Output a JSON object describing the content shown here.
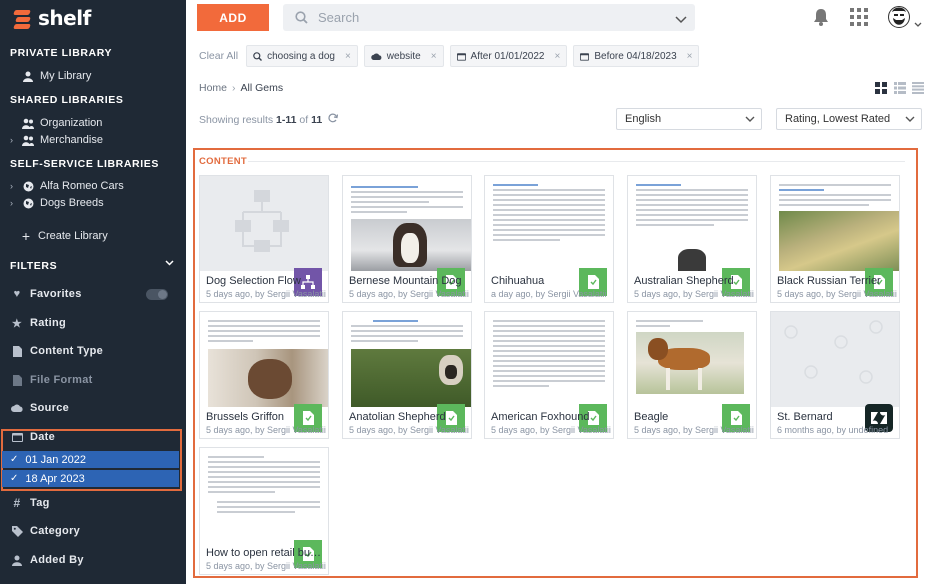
{
  "brand": {
    "name": "shelf"
  },
  "sidebar": {
    "private_heading": "PRIVATE LIBRARY",
    "my_library": "My Library",
    "shared_heading": "SHARED LIBRARIES",
    "organization": "Organization",
    "merchandise": "Merchandise",
    "self_service_heading": "SELF-SERVICE LIBRARIES",
    "alfa_romeo": "Alfa Romeo Cars",
    "dogs_breeds": "Dogs Breeds",
    "create_library": "Create Library",
    "filters_heading": "FILTERS",
    "filters": [
      {
        "label": "Favorites",
        "icon": "heart-icon"
      },
      {
        "label": "Rating",
        "icon": "star-icon"
      },
      {
        "label": "Content Type",
        "icon": "document-icon"
      },
      {
        "label": "File Format",
        "icon": "file-icon"
      },
      {
        "label": "Source",
        "icon": "cloud-icon"
      },
      {
        "label": "Date",
        "icon": "calendar-icon"
      },
      {
        "label": "Tag",
        "icon": "hashtag-icon"
      },
      {
        "label": "Category",
        "icon": "tag-icon"
      },
      {
        "label": "Added By",
        "icon": "user-icon"
      }
    ],
    "date_values": [
      "01 Jan 2022",
      "18 Apr 2023"
    ]
  },
  "topbar": {
    "add_label": "ADD",
    "search_placeholder": "Search"
  },
  "chips": {
    "clear_all": "Clear All",
    "items": [
      {
        "label": "choosing a dog",
        "icon": "search-icon"
      },
      {
        "label": "website",
        "icon": "cloud-icon"
      },
      {
        "label": "After 01/01/2022",
        "icon": "calendar-icon"
      },
      {
        "label": "Before 04/18/2023",
        "icon": "calendar-icon"
      }
    ]
  },
  "breadcrumb": {
    "home": "Home",
    "current": "All Gems"
  },
  "results": {
    "prefix": "Showing results ",
    "range": "1-11",
    "of": " of ",
    "total": "11"
  },
  "language_select": "English",
  "sort_select": "Rating, Lowest Rated",
  "content_label": "CONTENT",
  "cards": [
    {
      "title": "Dog Selection Flow",
      "meta": "5 days ago, by Sergii Vasalatii",
      "kind": "flow"
    },
    {
      "title": "Bernese Mountain Dog",
      "meta": "5 days ago, by Sergii Vasalatii",
      "kind": "doc"
    },
    {
      "title": "Chihuahua",
      "meta": "a day ago, by Sergii Vasalatii",
      "kind": "doc"
    },
    {
      "title": "Australian Shepherd",
      "meta": "5 days ago, by Sergii Vasalatii",
      "kind": "doc"
    },
    {
      "title": "Black Russian Terrier",
      "meta": "5 days ago, by Sergii Vasalatii",
      "kind": "doc"
    },
    {
      "title": "Brussels Griffon",
      "meta": "5 days ago, by Sergii Vasalatii",
      "kind": "doc"
    },
    {
      "title": "Anatolian Shepherd",
      "meta": "5 days ago, by Sergii Vasalatii",
      "kind": "doc"
    },
    {
      "title": "American Foxhound",
      "meta": "5 days ago, by Sergii Vasalatii",
      "kind": "doc"
    },
    {
      "title": "Beagle",
      "meta": "5 days ago, by Sergii Vasalatii",
      "kind": "photo"
    },
    {
      "title": "St. Bernard",
      "meta": "6 months ago, by undefined",
      "kind": "zendesk"
    },
    {
      "title": "How to open retail bus...",
      "meta": "5 days ago, by Sergii Vasalatii",
      "kind": "text"
    }
  ],
  "colors": {
    "accent": "#f26a3b",
    "sidebar": "#1f2935",
    "badge_green": "#5cb85c",
    "badge_purple": "#7255a8",
    "selected_blue": "#2d64b4"
  }
}
